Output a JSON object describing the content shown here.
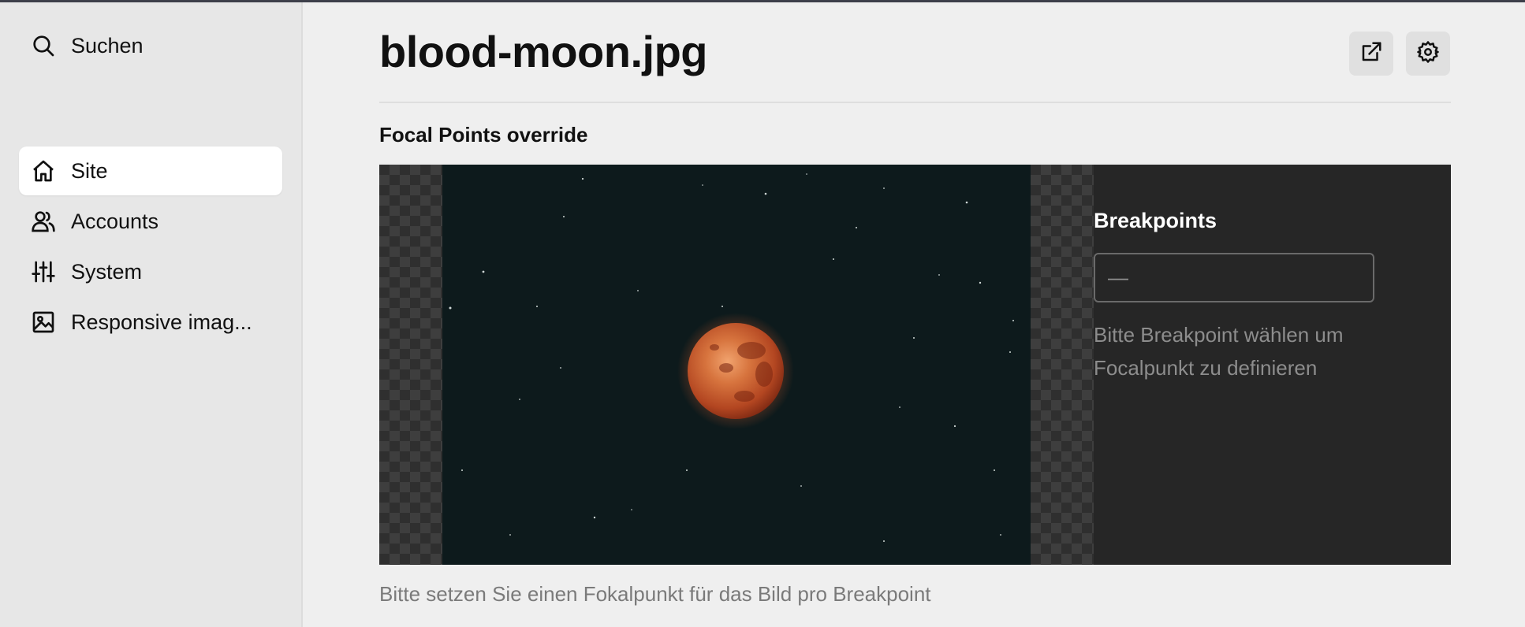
{
  "sidebar": {
    "search": {
      "label": "Suchen",
      "icon": "search-icon"
    },
    "items": [
      {
        "label": "Site",
        "icon": "home-icon",
        "active": true
      },
      {
        "label": "Accounts",
        "icon": "users-icon",
        "active": false
      },
      {
        "label": "System",
        "icon": "sliders-icon",
        "active": false
      },
      {
        "label": "Responsive imag...",
        "icon": "image-icon",
        "active": false
      }
    ]
  },
  "header": {
    "title": "blood-moon.jpg",
    "actions": [
      {
        "icon": "external-link-icon"
      },
      {
        "icon": "gear-icon"
      }
    ]
  },
  "section": {
    "title": "Focal Points override"
  },
  "panel": {
    "title": "Breakpoints",
    "select_value": "—",
    "hint": "Bitte Breakpoint wählen um Focalpunkt zu definieren"
  },
  "caption": "Bitte setzen Sie einen Fokalpunkt für das Bild pro Breakpoint",
  "colors": {
    "accent_bar": "#3d3f4a",
    "editor_bg": "#262626",
    "moon": "#c9572a",
    "sky": "#0d1a1c"
  }
}
